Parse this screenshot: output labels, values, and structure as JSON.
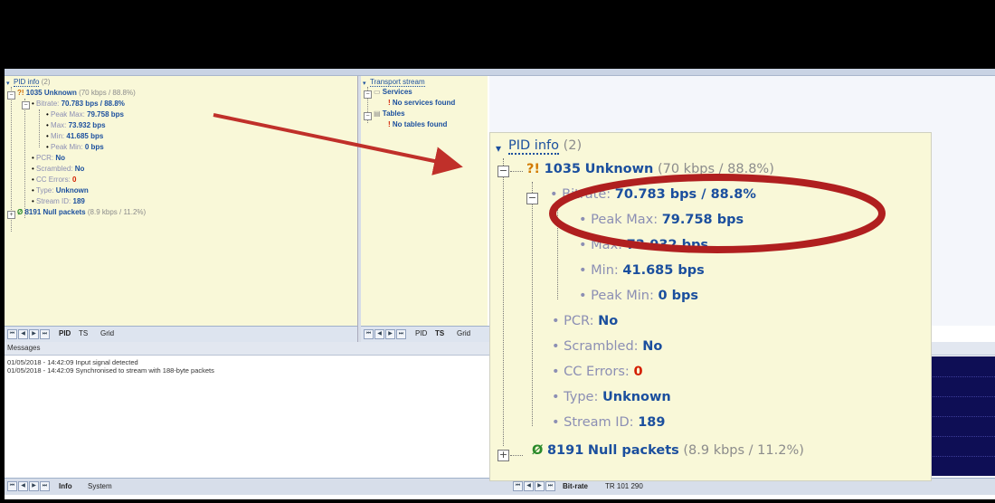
{
  "left_tree": {
    "root": "PID info",
    "root_count": "(2)",
    "pid1_marker": "?!",
    "pid1_number": "1035",
    "pid1_name": "Unknown",
    "pid1_rate": "(70 kbps / 88.8%)",
    "bitrate_label": "Bitrate:",
    "bitrate_value": "70.783 bps / 88.8%",
    "peakmax_label": "Peak Max:",
    "peakmax_value": "79.758 bps",
    "max_label": "Max:",
    "max_value": "73.932 bps",
    "min_label": "Min:",
    "min_value": "41.685 bps",
    "peakmin_label": "Peak Min:",
    "peakmin_value": "0 bps",
    "pcr_label": "PCR:",
    "pcr_value": "No",
    "scrambled_label": "Scrambled:",
    "scrambled_value": "No",
    "cc_label": "CC Errors:",
    "cc_value": "0",
    "type_label": "Type:",
    "type_value": "Unknown",
    "stream_label": "Stream ID:",
    "stream_value": "189",
    "pid2_marker": "Ø",
    "pid2_number": "8191",
    "pid2_name": "Null packets",
    "pid2_rate": "(8.9 kbps / 11.2%)"
  },
  "mid_tree": {
    "root": "Transport stream",
    "services": "Services",
    "no_services_marker": "!",
    "no_services": "No services found",
    "tables": "Tables",
    "no_tables_marker": "!",
    "no_tables": "No tables found"
  },
  "left_tabs": [
    "PID",
    "TS",
    "Grid"
  ],
  "mid_tabs": [
    "PID",
    "TS",
    "Grid"
  ],
  "messages": {
    "header": "Messages",
    "lines": [
      "01/05/2018 - 14:42:09 Input signal detected",
      "01/05/2018 - 14:42:09 Synchronised to stream with 188-byte packets"
    ]
  },
  "bottom_left_tabs": [
    "Info",
    "System"
  ],
  "bottom_right_tabs": [
    "Bit-rate",
    "TR 101 290"
  ],
  "zoom_tree": {
    "root": "PID info",
    "root_count": "(2)",
    "pid1_marker": "?!",
    "pid1_number": "1035",
    "pid1_name": "Unknown",
    "pid1_rate": "(70 kbps / 88.8%)",
    "bitrate_label": "Bitrate:",
    "bitrate_value": "70.783 bps / 88.8%",
    "peakmax_label": "Peak Max:",
    "peakmax_value": "79.758 bps",
    "max_label": "Max:",
    "max_value": "73.932 bps",
    "min_label": "Min:",
    "min_value": "41.685 bps",
    "peakmin_label": "Peak Min:",
    "peakmin_value": "0 bps",
    "pcr_label": "PCR:",
    "pcr_value": "No",
    "scrambled_label": "Scrambled:",
    "scrambled_value": "No",
    "cc_label": "CC Errors:",
    "cc_value": "0",
    "type_label": "Type:",
    "type_value": "Unknown",
    "stream_label": "Stream ID:",
    "stream_value": "189",
    "pid2_marker": "Ø",
    "pid2_number": "8191",
    "pid2_name": "Null packets",
    "pid2_rate": "(8.9 kbps / 11.2%)"
  },
  "colors": {
    "pane_bg": "#f9f8d8",
    "value_blue": "#1b4f9e",
    "label_lavender": "#8c8fb4",
    "ok_green": "#2a8a2a",
    "error_red": "#d41e00",
    "annotation_red": "#c0302a",
    "graph_bg": "#0e0e55"
  }
}
